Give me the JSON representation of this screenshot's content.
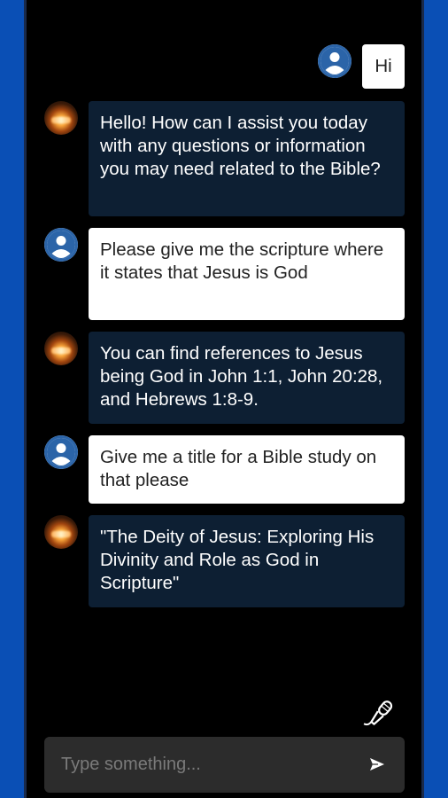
{
  "chat": {
    "messages": [
      {
        "role": "user",
        "text": "Hi"
      },
      {
        "role": "bot",
        "text": "Hello! How can I assist you today with any questions or information you may need related to the Bible?"
      },
      {
        "role": "user",
        "text": "Please give me the scripture where it states that Jesus is God"
      },
      {
        "role": "bot",
        "text": "You can find references to Jesus being God in John 1:1, John 20:28, and Hebrews 1:8-9."
      },
      {
        "role": "user",
        "text": "Give me a title for a Bible study on that please"
      },
      {
        "role": "bot",
        "text": "\"The Deity of Jesus: Exploring His Divinity and Role as God in Scripture\""
      }
    ]
  },
  "composer": {
    "placeholder": "Type something...",
    "send_icon": "send-icon",
    "mic_icon": "microphone-icon"
  },
  "colors": {
    "side_bars": "#0a4fb5",
    "background": "#000000",
    "bot_bubble": "#0d1f33",
    "user_bubble": "#ffffff",
    "user_avatar_ring": "#2b64a8",
    "input_bar": "#2c2c2c"
  }
}
